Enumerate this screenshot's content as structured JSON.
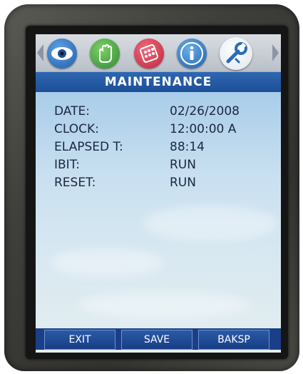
{
  "header": {
    "title": "MAINTENANCE"
  },
  "tabs": [
    {
      "icon": "eye-icon"
    },
    {
      "icon": "hand-icon"
    },
    {
      "icon": "keypad-icon"
    },
    {
      "icon": "info-icon"
    },
    {
      "icon": "wrench-icon",
      "selected": true
    }
  ],
  "fields": [
    {
      "label": "DATE:",
      "value": "02/26/2008"
    },
    {
      "label": "CLOCK:",
      "value": "12:00:00 A"
    },
    {
      "label": "ELAPSED T:",
      "value": "88:14"
    },
    {
      "label": "IBIT:",
      "value": "RUN"
    },
    {
      "label": "RESET:",
      "value": "RUN"
    }
  ],
  "softkeys": {
    "exit": "EXIT",
    "save": "SAVE",
    "baksp": "BAKSP"
  },
  "colors": {
    "title_bar": "#1c4f97",
    "softkey": "#1a3f86",
    "eye_tab": "#1f5fa8",
    "hand_tab": "#2e8a2e",
    "keypad_tab": "#c0243a",
    "info_tab": "#1f5fa8"
  }
}
